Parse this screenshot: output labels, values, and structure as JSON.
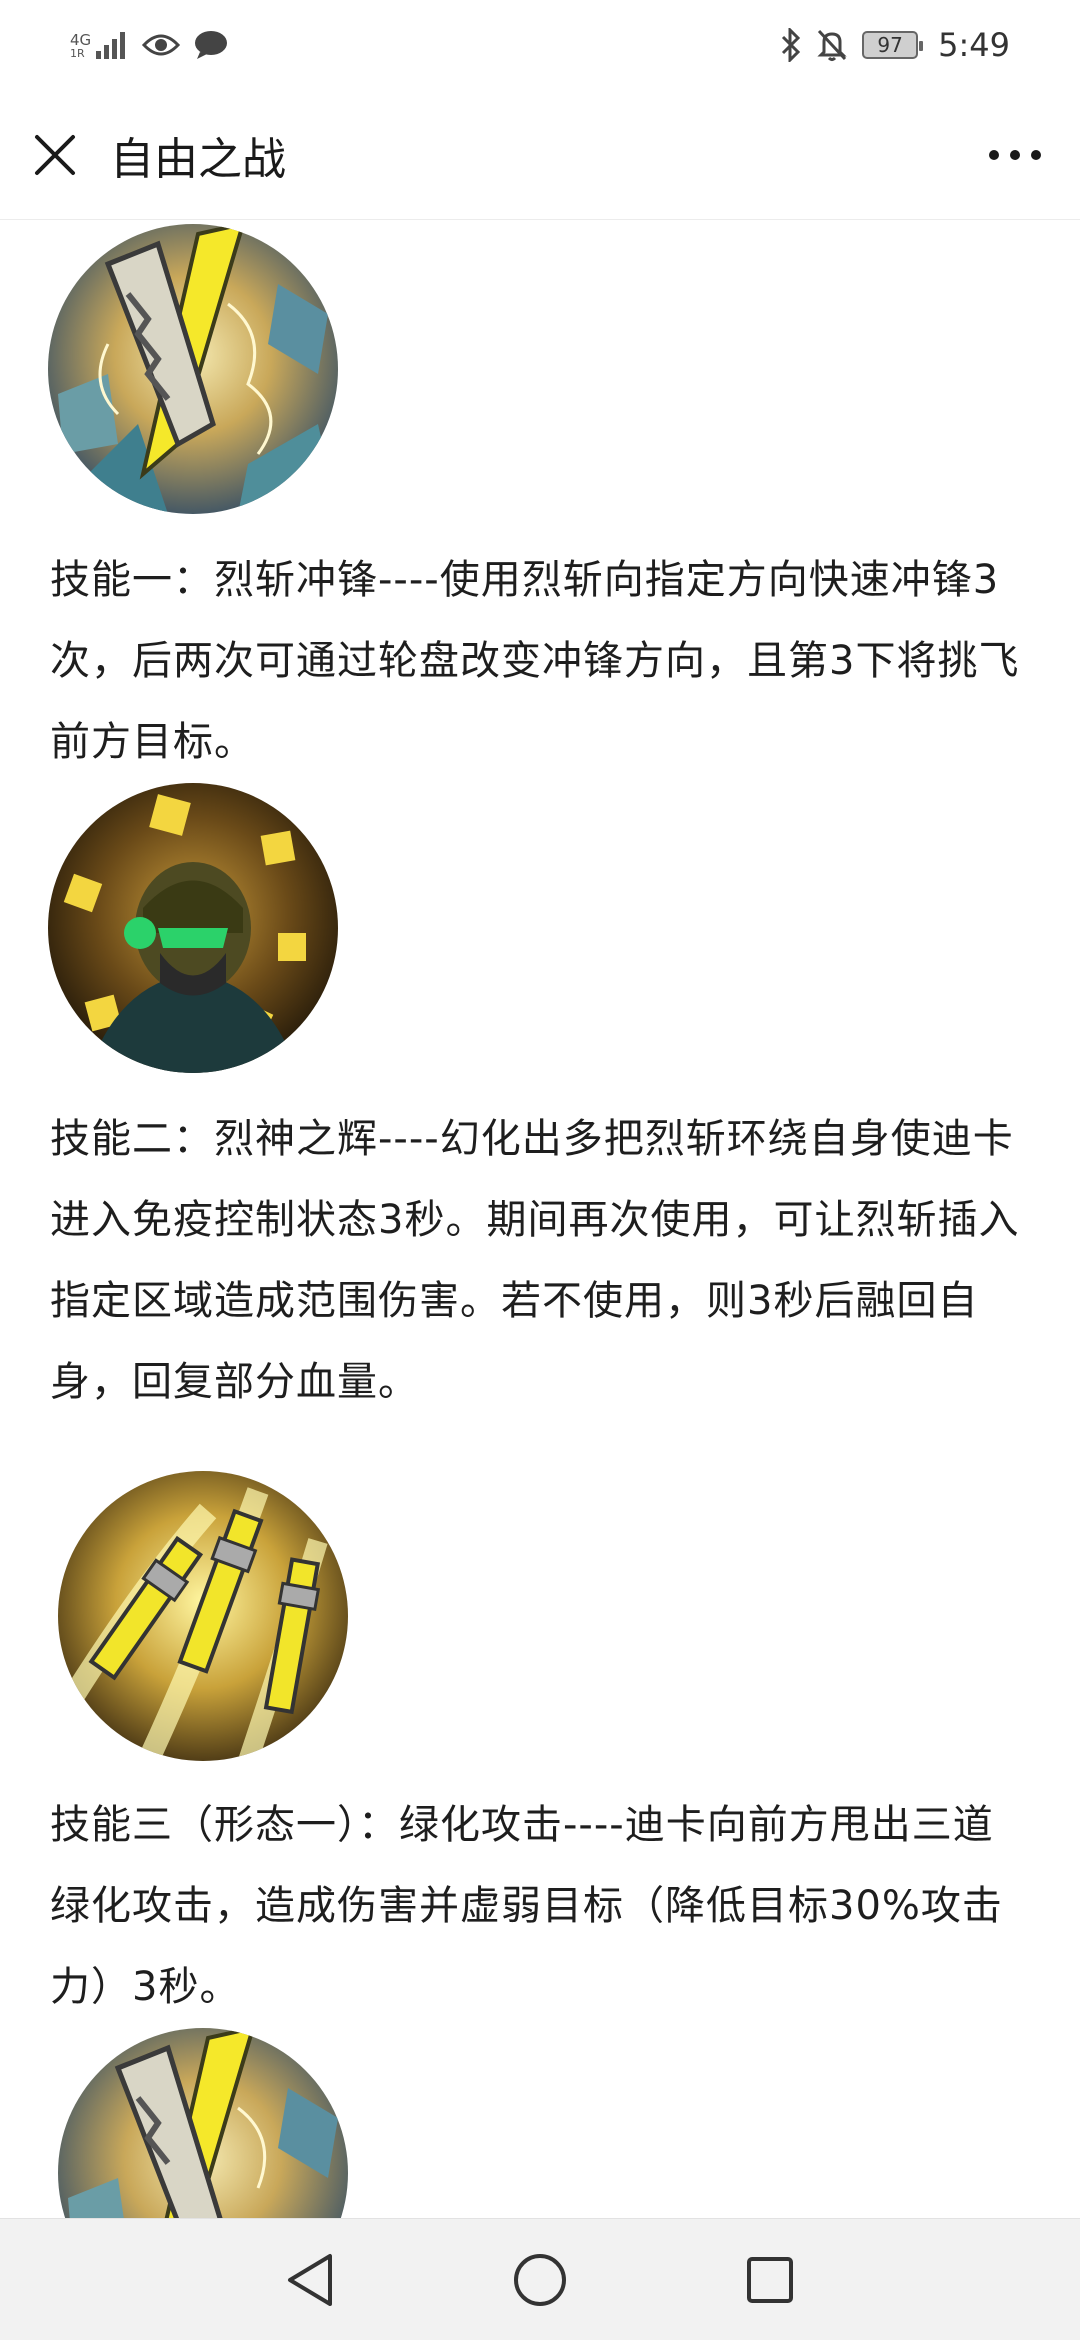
{
  "status_bar": {
    "network": "4G",
    "network_sub": "1R",
    "battery_level": "97",
    "time": "5:49"
  },
  "header": {
    "title": "自由之战"
  },
  "skills": [
    {
      "icon": "blade-charge-skill-icon",
      "text": "技能一：烈斩冲锋----使用烈斩向指定方向快速冲锋3次，后两次可通过轮盘改变冲锋方向，且第3下将挑飞前方目标。"
    },
    {
      "icon": "hero-aura-skill-icon",
      "text": "技能二：烈神之辉----幻化出多把烈斩环绕自身使迪卡进入免疫控制状态3秒。期间再次使用，可让烈斩插入指定区域造成范围伤害。若不使用，则3秒后融回自身，回复部分血量。"
    },
    {
      "icon": "triple-blade-skill-icon",
      "text": "技能三（形态一）：绿化攻击----迪卡向前方甩出三道绿化攻击，造成伤害并虚弱目标（降低目标30%攻击力）3秒。"
    },
    {
      "icon": "blade-charge-skill-icon"
    }
  ],
  "colors": {
    "background": "#ffffff",
    "text": "#1e1e1e",
    "navbar": "#f2f2f2"
  }
}
